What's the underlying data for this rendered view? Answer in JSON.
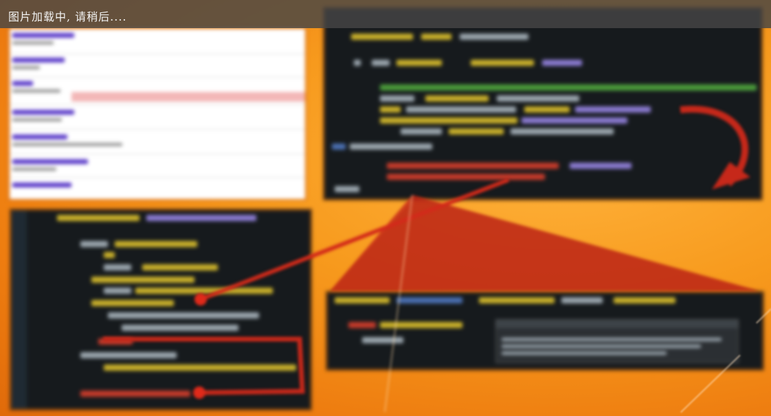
{
  "loading_overlay": {
    "text": "图片加载中, 请稍后...."
  },
  "colors": {
    "overlay_bg": "#464646",
    "background_orange": "#f79a1d",
    "code_bg": "#161a1d",
    "callout_red": "#c6281a"
  },
  "icons": {
    "curved_arrow": "curved-arrow-icon"
  }
}
